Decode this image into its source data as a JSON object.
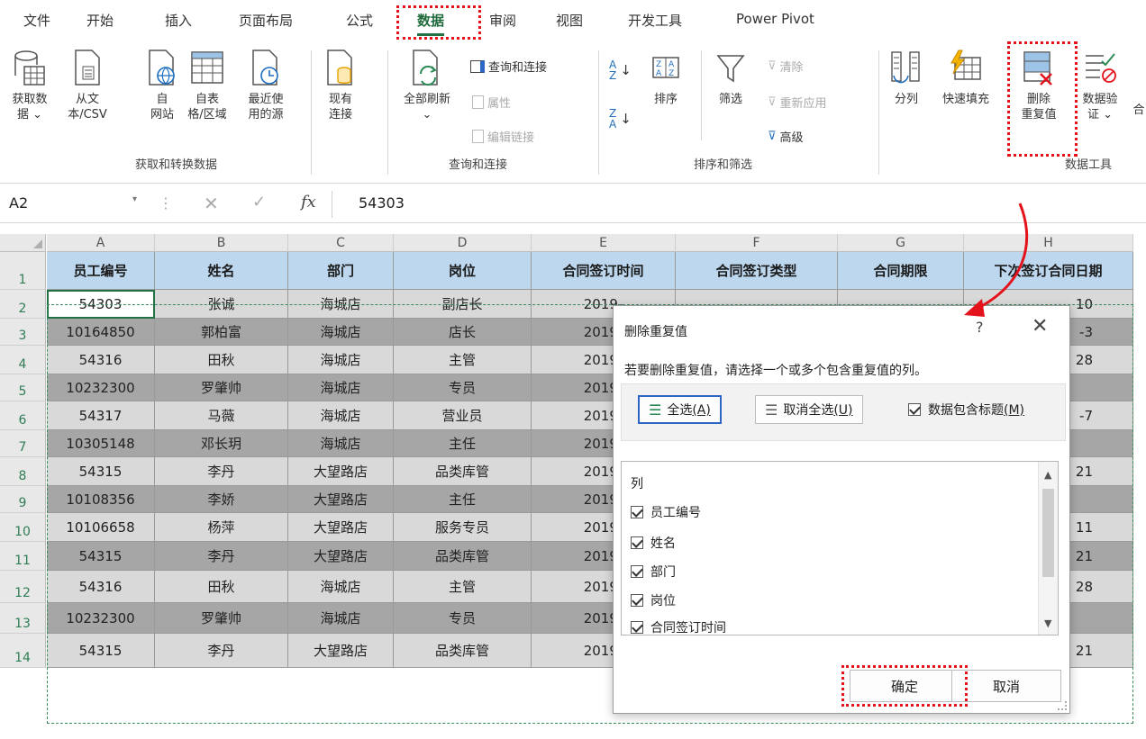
{
  "tabs": [
    "文件",
    "开始",
    "插入",
    "页面布局",
    "公式",
    "数据",
    "审阅",
    "视图",
    "开发工具",
    "Power Pivot"
  ],
  "active_tab": "数据",
  "ribbon": {
    "get_data": "获取数\n据 ⌄",
    "from_text": "从文\n本/CSV",
    "from_web": "自\n网站",
    "from_table": "自表\n格/区域",
    "recent_sources": "最近使\n用的源",
    "existing_conn": "现有\n连接",
    "group_get": "获取和转换数据",
    "refresh_all": "全部刷新\n⌄",
    "queries_conn": "查询和连接",
    "properties": "属性",
    "edit_links": "编辑链接",
    "group_queries": "查询和连接",
    "sort": "排序",
    "filter": "筛选",
    "clear": "清除",
    "reapply": "重新应用",
    "advanced": "高级",
    "group_sort": "排序和筛选",
    "text_to_columns": "分列",
    "flash_fill": "快速填充",
    "remove_duplicates": "删除\n重复值",
    "data_validation": "数据验\n证 ⌄",
    "extra": "合",
    "group_tools": "数据工具"
  },
  "formula_bar": {
    "name_box": "A2",
    "fx": "fx",
    "value": "54303"
  },
  "sheet": {
    "columns": [
      "A",
      "B",
      "C",
      "D",
      "E",
      "F",
      "G",
      "H"
    ],
    "header": [
      "员工编号",
      "姓名",
      "部门",
      "岗位",
      "合同签订时间",
      "合同签订类型",
      "合同期限",
      "下次签订合同日期"
    ],
    "rows": [
      {
        "num": "2",
        "a": "54303",
        "b": "张诚",
        "c": "海城店",
        "d": "副店长",
        "e": "2019-",
        "h": "10"
      },
      {
        "num": "3",
        "a": "10164850",
        "b": "郭柏富",
        "c": "海城店",
        "d": "店长",
        "e": "2019-",
        "h": "-3"
      },
      {
        "num": "4",
        "a": "54316",
        "b": "田秋",
        "c": "海城店",
        "d": "主管",
        "e": "2019-",
        "h": "28"
      },
      {
        "num": "5",
        "a": "10232300",
        "b": "罗肇帅",
        "c": "海城店",
        "d": "专员",
        "e": "2019-",
        "h": ""
      },
      {
        "num": "6",
        "a": "54317",
        "b": "马薇",
        "c": "海城店",
        "d": "营业员",
        "e": "2019-",
        "h": "-7"
      },
      {
        "num": "7",
        "a": "10305148",
        "b": "邓长玥",
        "c": "海城店",
        "d": "主任",
        "e": "2019-",
        "h": ""
      },
      {
        "num": "8",
        "a": "54315",
        "b": "李丹",
        "c": "大望路店",
        "d": "品类库管",
        "e": "2019-",
        "h": "21"
      },
      {
        "num": "9",
        "a": "10108356",
        "b": "李娇",
        "c": "大望路店",
        "d": "主任",
        "e": "2019-",
        "h": ""
      },
      {
        "num": "10",
        "a": "10106658",
        "b": "杨萍",
        "c": "大望路店",
        "d": "服务专员",
        "e": "2019-",
        "h": "11"
      },
      {
        "num": "11",
        "a": "54315",
        "b": "李丹",
        "c": "大望路店",
        "d": "品类库管",
        "e": "2019-",
        "h": "21"
      },
      {
        "num": "12",
        "a": "54316",
        "b": "田秋",
        "c": "海城店",
        "d": "主管",
        "e": "2019-",
        "h": "28"
      },
      {
        "num": "13",
        "a": "10232300",
        "b": "罗肇帅",
        "c": "海城店",
        "d": "专员",
        "e": "2019-",
        "h": ""
      },
      {
        "num": "14",
        "a": "54315",
        "b": "李丹",
        "c": "大望路店",
        "d": "品类库管",
        "e": "2019-",
        "h": "21"
      }
    ],
    "header_row_num": "1"
  },
  "dialog": {
    "title": "删除重复值",
    "help": "?",
    "close": "✕",
    "description": "若要删除重复值，请选择一个或多个包含重复值的列。",
    "select_all": "全选",
    "select_all_key": "(A)",
    "unselect_all": "取消全选",
    "unselect_all_key": "(U)",
    "has_headers": "数据包含标题",
    "has_headers_key": "(M)",
    "list_caption": "列",
    "columns": [
      "员工编号",
      "姓名",
      "部门",
      "岗位",
      "合同签订时间"
    ],
    "ok": "确定",
    "cancel": "取消"
  },
  "colors": {
    "accent": "#217346",
    "annotation": "#e3121b",
    "header_fill": "#bdd7ee"
  }
}
